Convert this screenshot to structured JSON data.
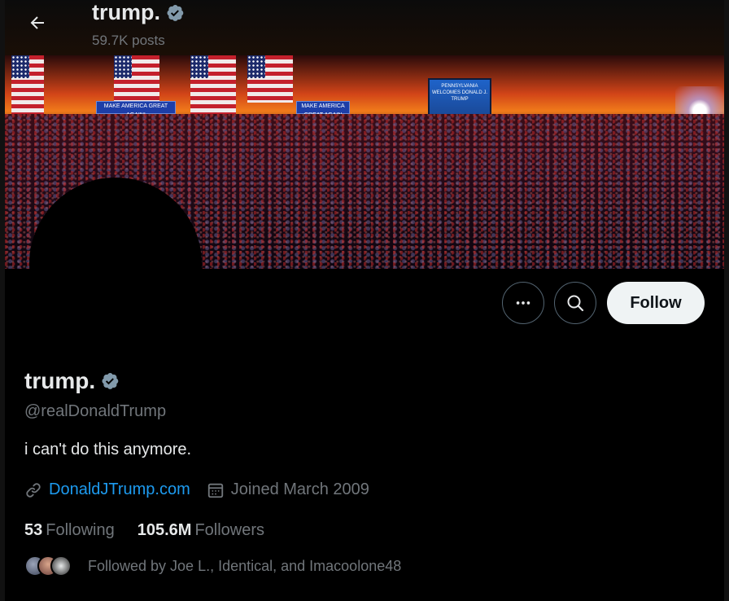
{
  "header": {
    "title": "trump.",
    "posts": "59.7K posts"
  },
  "banner": {
    "sign_text_1": "MAKE AMERICA GREAT AGAIN!",
    "sign_text_2": "MAKE AMERICA GREAT AGAIN",
    "screen_text": "PENNSYLVANIA WELCOMES DONALD J. TRUMP"
  },
  "actions": {
    "follow_label": "Follow"
  },
  "profile": {
    "name": "trump.",
    "handle": "@realDonaldTrump",
    "bio": "i can't do this anymore.",
    "website": "DonaldJTrump.com",
    "joined": "Joined March 2009",
    "following_count": "53",
    "following_label": "Following",
    "followers_count": "105.6M",
    "followers_label": "Followers",
    "followed_by": "Followed by Joe L., Identical, and Imacoolone48"
  },
  "colors": {
    "background": "#000000",
    "text_primary": "#e7e9ea",
    "text_secondary": "#71767b",
    "link": "#1d9bf0",
    "follow_button_bg": "#eff3f4",
    "verified_badge": "#829aab"
  },
  "icons": [
    "back-arrow-icon",
    "verified-badge-icon",
    "more-icon",
    "search-icon",
    "link-icon",
    "calendar-icon"
  ]
}
